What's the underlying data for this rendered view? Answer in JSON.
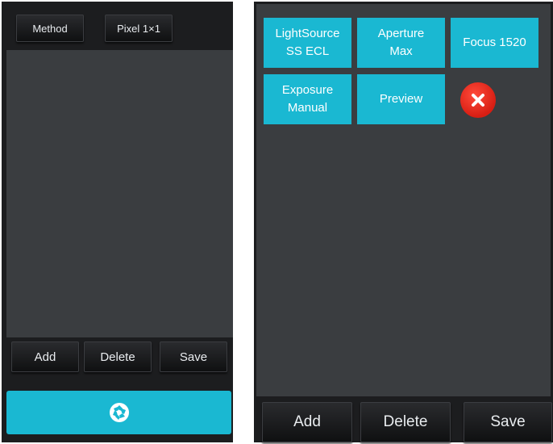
{
  "left_panel": {
    "top_buttons": {
      "method_label": "Method",
      "pixel_label": "Pixel 1×1"
    },
    "bottom_buttons": {
      "add_label": "Add",
      "delete_label": "Delete",
      "save_label": "Save"
    },
    "capture_icon": "camera-shutter-icon"
  },
  "right_panel": {
    "tiles": [
      {
        "lines": [
          "LightSource",
          "SS ECL"
        ]
      },
      {
        "lines": [
          "Aperture",
          "Max"
        ]
      },
      {
        "lines": [
          "Focus 1520"
        ]
      },
      {
        "lines": [
          "Exposure",
          "Manual"
        ]
      },
      {
        "lines": [
          "Preview"
        ]
      }
    ],
    "delete_icon": "close-icon",
    "bottom_buttons": {
      "add_label": "Add",
      "delete_label": "Delete",
      "save_label": "Save"
    }
  },
  "colors": {
    "accent": "#1ab8d2",
    "panel_bg": "#1c1d1f",
    "work_area": "#3a3d40",
    "delete_red": "#e0281b"
  }
}
